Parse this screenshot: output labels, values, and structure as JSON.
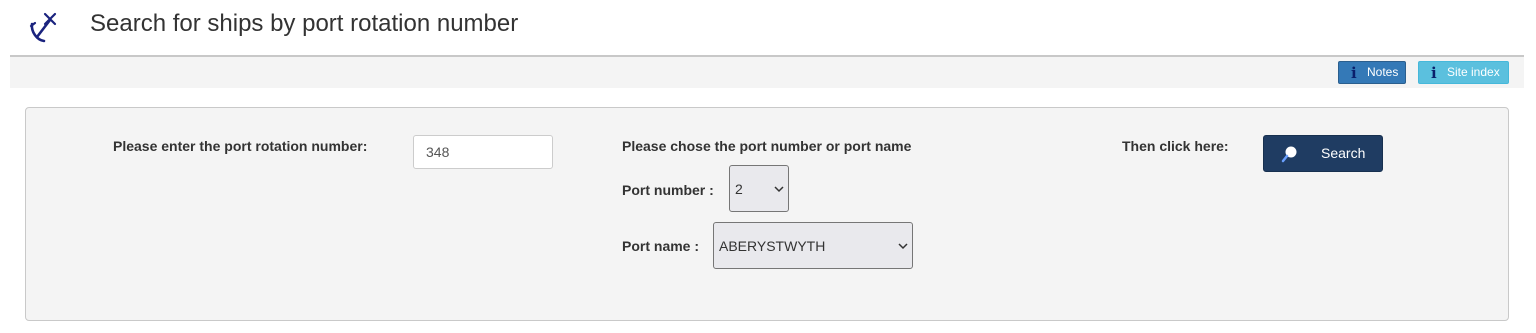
{
  "header": {
    "title": "Search for ships by port rotation number",
    "logo_icon": "anchor-icon"
  },
  "toolbar": {
    "notes_label": "Notes",
    "site_index_label": "Site index",
    "info_glyph": "i"
  },
  "form": {
    "rotation_label": "Please enter the port rotation number:",
    "rotation_value": "348",
    "port_prompt": "Please chose the port number or port name",
    "port_number_label": "Port number :",
    "port_number_value": "2",
    "port_name_label": "Port name :",
    "port_name_value": "ABERYSTWYTH",
    "then_label": "Then click here:",
    "search_label": "Search"
  },
  "colors": {
    "search_button": "#1f3c62",
    "notes_button": "#3479b7",
    "site_index_button": "#5bc0de",
    "panel_background": "#f4f4f4"
  }
}
